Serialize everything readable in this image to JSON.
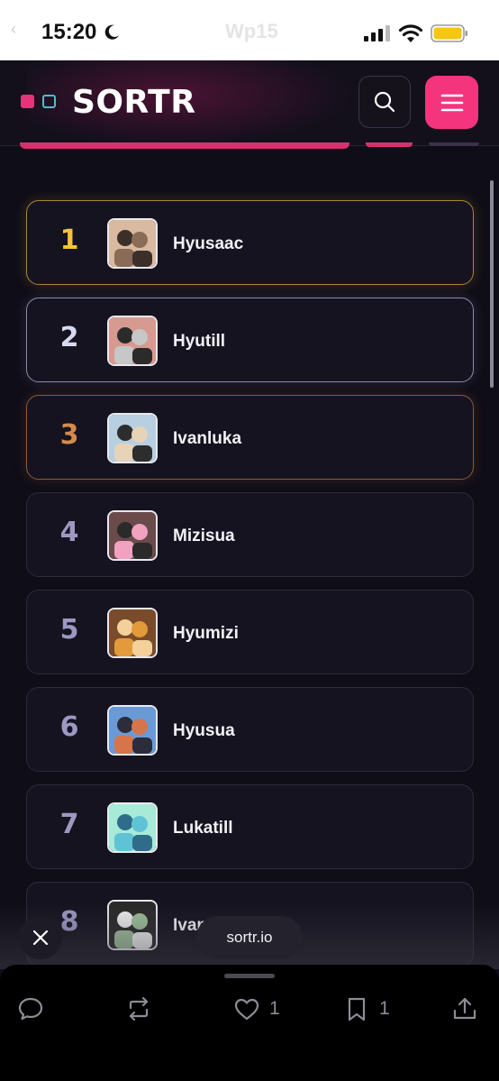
{
  "status": {
    "time": "15:20",
    "center": "Wp15",
    "back": "‹"
  },
  "app": {
    "logo": "SORTR",
    "accent": "#f4357e",
    "teal": "#45c2c9"
  },
  "rankings": [
    {
      "rank": "1",
      "name": "Hyusaac",
      "tier": "gold"
    },
    {
      "rank": "2",
      "name": "Hyutill",
      "tier": "silver"
    },
    {
      "rank": "3",
      "name": "Ivanluka",
      "tier": "bronze"
    },
    {
      "rank": "4",
      "name": "Mizisua",
      "tier": "normal"
    },
    {
      "rank": "5",
      "name": "Hyumizi",
      "tier": "normal"
    },
    {
      "rank": "6",
      "name": "Hyusua",
      "tier": "normal"
    },
    {
      "rank": "7",
      "name": "Lukatill",
      "tier": "normal"
    },
    {
      "rank": "8",
      "name": "Ivan",
      "tier": "normal"
    }
  ],
  "overlay": {
    "url": "sortr.io"
  },
  "actions": {
    "comment_icon": "comment-icon",
    "repost_icon": "repost-icon",
    "like_count": "1",
    "bookmark_count": "1",
    "share_icon": "share-icon"
  }
}
